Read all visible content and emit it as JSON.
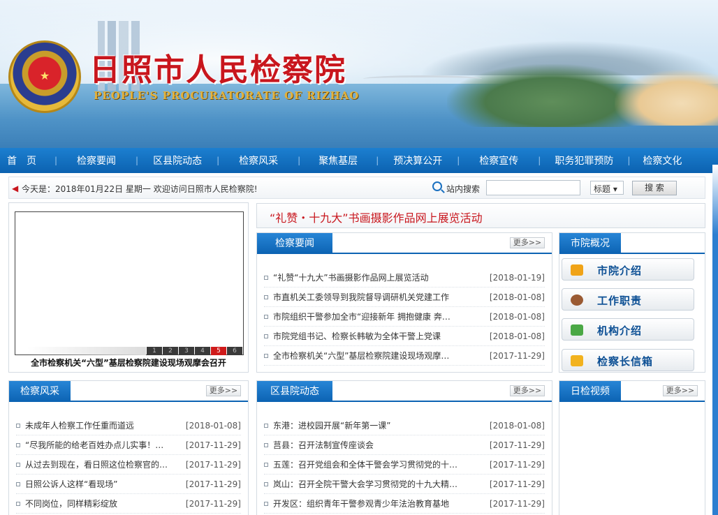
{
  "banner": {
    "title": "日照市人民检察院",
    "subtitle": "PEOPLE'S PROCURATORATE OF RIZHAO",
    "emblem_glyph": "★"
  },
  "nav": {
    "items": [
      {
        "label": "首　页"
      },
      {
        "label": "检察要闻"
      },
      {
        "label": "区县院动态"
      },
      {
        "label": "检察风采"
      },
      {
        "label": "聚焦基层"
      },
      {
        "label": "预决算公开"
      },
      {
        "label": "检察宣传"
      },
      {
        "label": "职务犯罪预防"
      },
      {
        "label": "检察文化"
      }
    ],
    "separator": "|"
  },
  "welcome": {
    "speaker_icon": "◀",
    "date_text": "今天是：2018年01月22日 星期一 欢迎访问日照市人民检察院!",
    "search_label": "站内搜索",
    "search_value": "",
    "select_value": "标题 ▾",
    "search_button": "搜 索"
  },
  "slideshow": {
    "caption": "全市检察机关“六型”基层检察院建设现场观摩会召开",
    "pages": [
      "1",
      "2",
      "3",
      "4",
      "5",
      "6"
    ],
    "active_page": 5
  },
  "headline": {
    "text": "“礼赞・十九大”书画摄影作品网上展览活动"
  },
  "more_label": "更多>>",
  "news": {
    "tab": "检察要闻",
    "items": [
      {
        "title": "“礼赞“十九大”书画摄影作品网上展览活动",
        "date": "[2018-01-19]"
      },
      {
        "title": "市直机关工委领导到我院督导调研机关党建工作",
        "date": "[2018-01-08]"
      },
      {
        "title": "市院组织干警参加全市“迎接新年 拥抱健康 奔…",
        "date": "[2018-01-08]"
      },
      {
        "title": "市院党组书记、检察长韩敏为全体干警上党课",
        "date": "[2018-01-08]"
      },
      {
        "title": "全市检察机关“六型”基层检察院建设现场观摩…",
        "date": "[2017-11-29]"
      }
    ]
  },
  "overview": {
    "tab": "市院概况",
    "buttons": [
      {
        "label": "市院介绍",
        "icon": "folder-icon",
        "color": "#f0a317"
      },
      {
        "label": "工作职责",
        "icon": "people-icon",
        "color": "#9a5a33"
      },
      {
        "label": "机构介绍",
        "icon": "arrow-icon",
        "color": "#4aa845"
      },
      {
        "label": "检察长信箱",
        "icon": "mail-icon",
        "color": "#f2b21e"
      }
    ]
  },
  "style": {
    "tab": "检察风采",
    "items": [
      {
        "title": "未成年人检察工作任重而道远",
        "date": "[2018-01-08]"
      },
      {
        "title": "“尽我所能的给老百姓办点儿实事！…",
        "date": "[2017-11-29]"
      },
      {
        "title": "从过去到现在，看日照这位检察官的…",
        "date": "[2017-11-29]"
      },
      {
        "title": "日照公诉人这样“看现场”",
        "date": "[2017-11-29]"
      },
      {
        "title": "不同岗位，同样精彩绽放",
        "date": "[2017-11-29]"
      }
    ]
  },
  "district": {
    "tab": "区县院动态",
    "items": [
      {
        "title": "东港：进校园开展“新年第一课”",
        "date": "[2018-01-08]"
      },
      {
        "title": "莒县：召开法制宣传座谈会",
        "date": "[2017-11-29]"
      },
      {
        "title": "五莲：召开党组会和全体干警会学习贯彻党的十…",
        "date": "[2017-11-29]"
      },
      {
        "title": "岚山：召开全院干警大会学习贯彻党的十九大精…",
        "date": "[2017-11-29]"
      },
      {
        "title": "开发区：组织青年干警参观青少年法治教育基地",
        "date": "[2017-11-29]"
      }
    ]
  },
  "video": {
    "tab": "日检视频"
  },
  "colors": {
    "nav_blue": "#0c62b0",
    "title_red": "#c8161d",
    "link_blue": "#0c4f94"
  }
}
